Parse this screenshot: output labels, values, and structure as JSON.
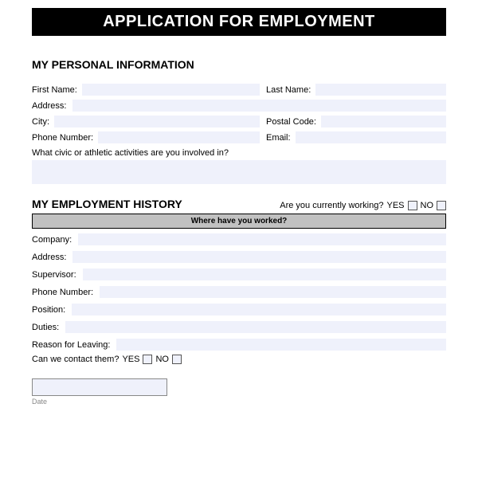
{
  "title": "APPLICATION FOR EMPLOYMENT",
  "personal": {
    "heading": "MY PERSONAL INFORMATION",
    "first_name_label": "First Name:",
    "first_name_value": "",
    "last_name_label": "Last Name:",
    "last_name_value": "",
    "address_label": "Address:",
    "address_value": "",
    "city_label": "City:",
    "city_value": "",
    "postal_label": "Postal Code:",
    "postal_value": "",
    "phone_label": "Phone Number:",
    "phone_value": "",
    "email_label": "Email:",
    "email_value": "",
    "activities_label": "What civic or athletic activities are you involved in?",
    "activities_value": ""
  },
  "employment": {
    "heading": "MY EMPLOYMENT HISTORY",
    "currently_working_label": "Are you currently working?",
    "yes_label": "YES",
    "no_label": "NO",
    "where_label": "Where have you worked?",
    "company_label": "Company:",
    "company_value": "",
    "address_label": "Address:",
    "address_value": "",
    "supervisor_label": "Supervisor:",
    "supervisor_value": "",
    "phone_label": "Phone Number:",
    "phone_value": "",
    "position_label": "Position:",
    "position_value": "",
    "duties_label": "Duties:",
    "duties_value": "",
    "reason_label": "Reason for Leaving:",
    "reason_value": "",
    "contact_label": "Can we contact them?",
    "contact_yes": "YES",
    "contact_no": "NO"
  },
  "date": {
    "value": "",
    "caption": "Date"
  }
}
